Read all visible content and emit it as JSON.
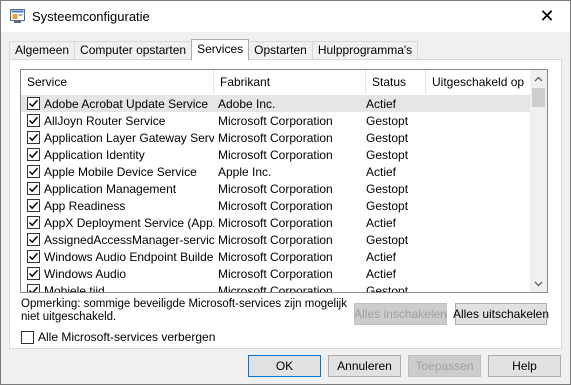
{
  "window": {
    "title": "Systeemconfiguratie",
    "close_glyph": "✕"
  },
  "tabs": [
    {
      "label": "Algemeen"
    },
    {
      "label": "Computer opstarten"
    },
    {
      "label": "Services",
      "active": true
    },
    {
      "label": "Opstarten"
    },
    {
      "label": "Hulpprogramma's"
    }
  ],
  "columns": {
    "service": "Service",
    "maker": "Fabrikant",
    "status": "Status",
    "disabled": "Uitgeschakeld op"
  },
  "rows": [
    {
      "checked": true,
      "service": "Adobe Acrobat Update Service",
      "maker": "Adobe Inc.",
      "status": "Actief",
      "disabled": ""
    },
    {
      "checked": true,
      "service": "AllJoyn Router Service",
      "maker": "Microsoft Corporation",
      "status": "Gestopt",
      "disabled": ""
    },
    {
      "checked": true,
      "service": "Application Layer Gateway Service",
      "maker": "Microsoft Corporation",
      "status": "Gestopt",
      "disabled": ""
    },
    {
      "checked": true,
      "service": "Application Identity",
      "maker": "Microsoft Corporation",
      "status": "Gestopt",
      "disabled": ""
    },
    {
      "checked": true,
      "service": "Apple Mobile Device Service",
      "maker": "Apple Inc.",
      "status": "Actief",
      "disabled": ""
    },
    {
      "checked": true,
      "service": "Application Management",
      "maker": "Microsoft Corporation",
      "status": "Gestopt",
      "disabled": ""
    },
    {
      "checked": true,
      "service": "App Readiness",
      "maker": "Microsoft Corporation",
      "status": "Gestopt",
      "disabled": ""
    },
    {
      "checked": true,
      "service": "AppX Deployment Service (AppX...",
      "maker": "Microsoft Corporation",
      "status": "Actief",
      "disabled": ""
    },
    {
      "checked": true,
      "service": "AssignedAccessManager-service",
      "maker": "Microsoft Corporation",
      "status": "Gestopt",
      "disabled": ""
    },
    {
      "checked": true,
      "service": "Windows Audio Endpoint Builder",
      "maker": "Microsoft Corporation",
      "status": "Actief",
      "disabled": ""
    },
    {
      "checked": true,
      "service": "Windows Audio",
      "maker": "Microsoft Corporation",
      "status": "Actief",
      "disabled": ""
    },
    {
      "checked": true,
      "service": "Mobiele tijd",
      "maker": "Microsoft Corporation",
      "status": "Gestopt",
      "disabled": ""
    }
  ],
  "note": "Opmerking: sommige beveiligde Microsoft-services zijn mogelijk niet uitgeschakeld.",
  "buttons": {
    "enable_all": "Alles inschakelen",
    "disable_all": "Alles uitschakelen",
    "ok": "OK",
    "cancel": "Annuleren",
    "apply": "Toepassen",
    "help": "Help"
  },
  "hide_ms": {
    "label": "Alle Microsoft-services verbergen",
    "checked": false
  },
  "icons": {
    "app": "msconfig-icon",
    "close": "close-icon",
    "scroll_up": "scroll-up-icon",
    "scroll_down": "scroll-down-icon",
    "check": "checkmark-icon"
  }
}
